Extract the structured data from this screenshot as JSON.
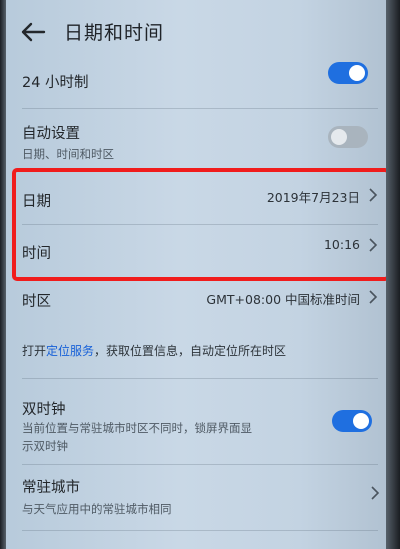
{
  "header": {
    "title": "日期和时间",
    "back_icon": "arrow-left-icon"
  },
  "settings": {
    "h24": {
      "label": "24 小时制",
      "enabled": true
    },
    "auto": {
      "label": "自动设置",
      "sub": "日期、时间和时区",
      "enabled": false
    },
    "date": {
      "label": "日期",
      "value": "2019年7月23日"
    },
    "time": {
      "label": "时间",
      "value": "10:16"
    },
    "timezone": {
      "label": "时区",
      "value": "GMT+08:00 中国标准时间"
    },
    "location_hint": {
      "prefix": "打开",
      "link": "定位服务",
      "suffix": "，获取位置信息，自动定位所在时区"
    },
    "dual_clock": {
      "label": "双时钟",
      "sub_line1": "当前位置与常驻城市时区不同时，锁屏界面显",
      "sub_line2": "示双时钟",
      "enabled": true
    },
    "home_city": {
      "label": "常驻城市",
      "sub": "与天气应用中的常驻城市相同"
    }
  },
  "colors": {
    "accent": "#1f6fe0",
    "highlight": "#f01c1c",
    "link": "#1760d8"
  }
}
